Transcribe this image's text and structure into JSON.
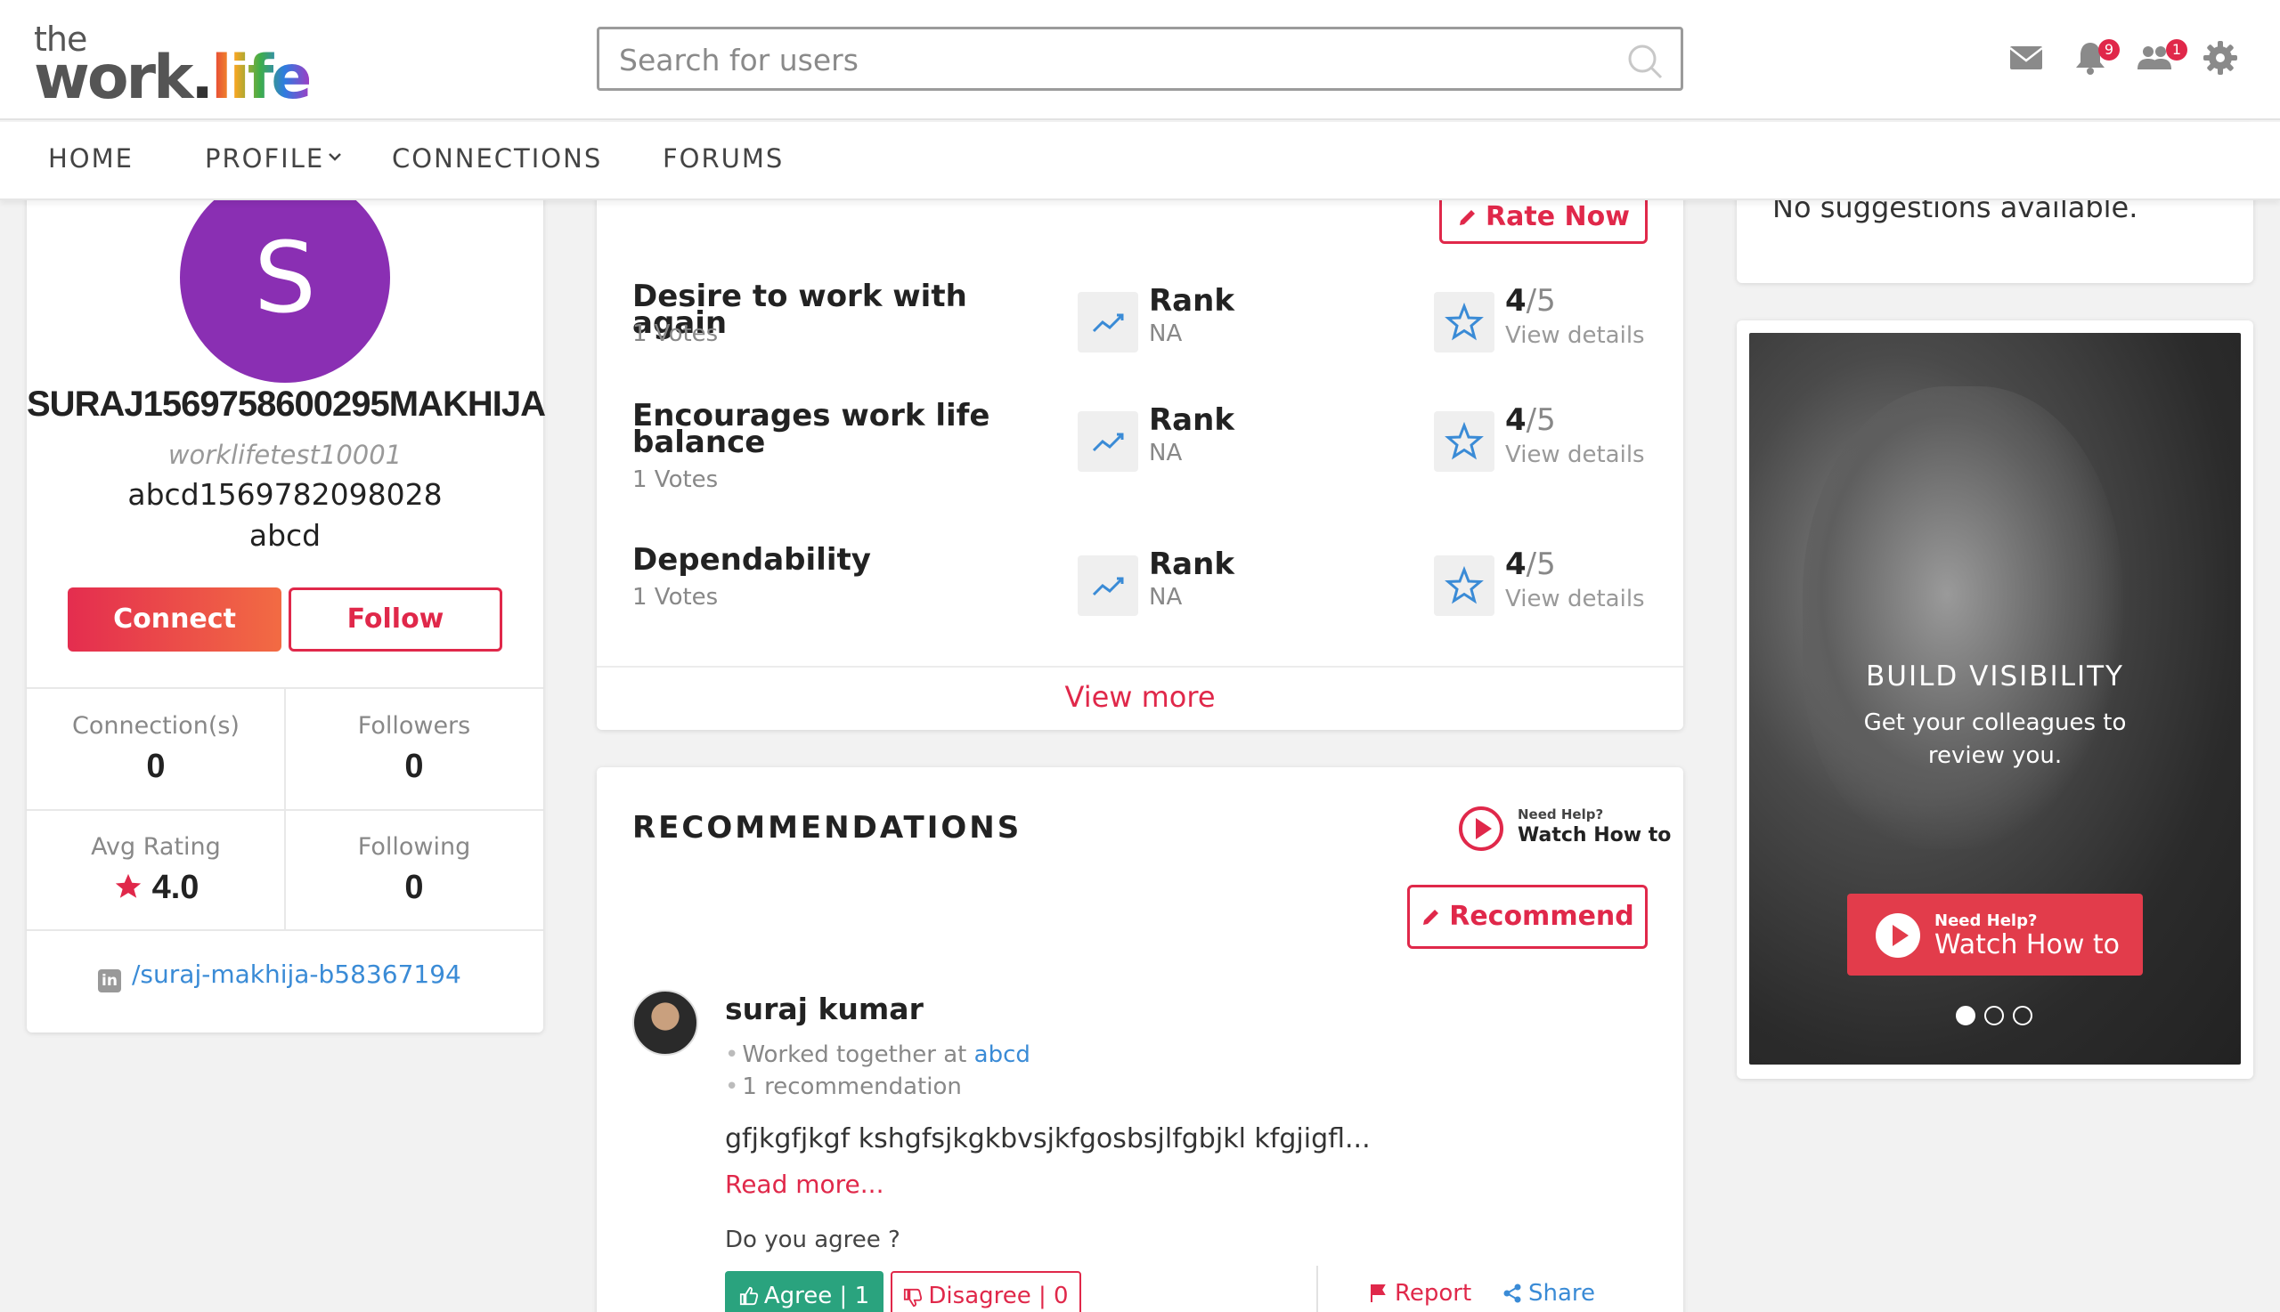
{
  "header": {
    "logo_the": "the",
    "logo_work": "work",
    "logo_dot": ".",
    "logo_life": "life",
    "search_placeholder": "Search for users",
    "icons": [
      "mail-icon",
      "bell-icon",
      "users-icon",
      "gear-icon"
    ],
    "notification_count": "9",
    "friend_request_count": "1"
  },
  "nav": {
    "home": "HOME",
    "profile": "PROFILE",
    "connections": "CONNECTIONS",
    "forums": "FORUMS"
  },
  "profile": {
    "initial": "S",
    "name": "SURAJ1569758600295MAKHIJA",
    "username": "worklifetest10001",
    "line1": "abcd1569782098028",
    "line2": "abcd",
    "connect_label": "Connect",
    "follow_label": "Follow",
    "stats": {
      "connections_label": "Connection(s)",
      "connections_value": "0",
      "followers_label": "Followers",
      "followers_value": "0",
      "avg_rating_label": "Avg Rating",
      "avg_rating_value": "4.0",
      "following_label": "Following",
      "following_value": "0"
    },
    "linkedin": "/suraj-makhija-b58367194"
  },
  "ratings": {
    "rate_now_label": "Rate Now",
    "rows": [
      {
        "title": "Desire to work with again",
        "votes": "1 Votes",
        "rank_label": "Rank",
        "rank_value": "NA",
        "score": "4",
        "score_max": "/5",
        "details": "View details"
      },
      {
        "title": "Encourages work life balance",
        "votes": "1 Votes",
        "rank_label": "Rank",
        "rank_value": "NA",
        "score": "4",
        "score_max": "/5",
        "details": "View details"
      },
      {
        "title": "Dependability",
        "votes": "1 Votes",
        "rank_label": "Rank",
        "rank_value": "NA",
        "score": "4",
        "score_max": "/5",
        "details": "View details"
      }
    ],
    "view_more": "View more"
  },
  "recommendations": {
    "title": "RECOMMENDATIONS",
    "help_small": "Need Help?",
    "help_big": "Watch How to",
    "recommend_label": "Recommend",
    "item": {
      "name": "suraj kumar",
      "worked_prefix": "Worked together at",
      "worked_company": "abcd",
      "count": "1 recommendation",
      "text": "gfjkgfjkgf kshgfsjkgkbvsjkfgosbsjlfgbjkl kfgjigfl...",
      "read_more": "Read more...",
      "agree_question": "Do you agree ?",
      "agree_label": "Agree | 1",
      "disagree_label": "Disagree | 0",
      "report_label": "Report",
      "share_label": "Share"
    }
  },
  "suggestions": {
    "text": "No suggestions available."
  },
  "promo": {
    "title": "BUILD VISIBILITY",
    "subtitle": "Get your colleagues to review you.",
    "help_small": "Need Help?",
    "help_big": "Watch How to",
    "slides": 3,
    "active_slide": 1
  },
  "colors": {
    "accent": "#e0284a",
    "link": "#3a8bd6",
    "agree": "#2aa37e",
    "avatar": "#8a2fb3"
  }
}
